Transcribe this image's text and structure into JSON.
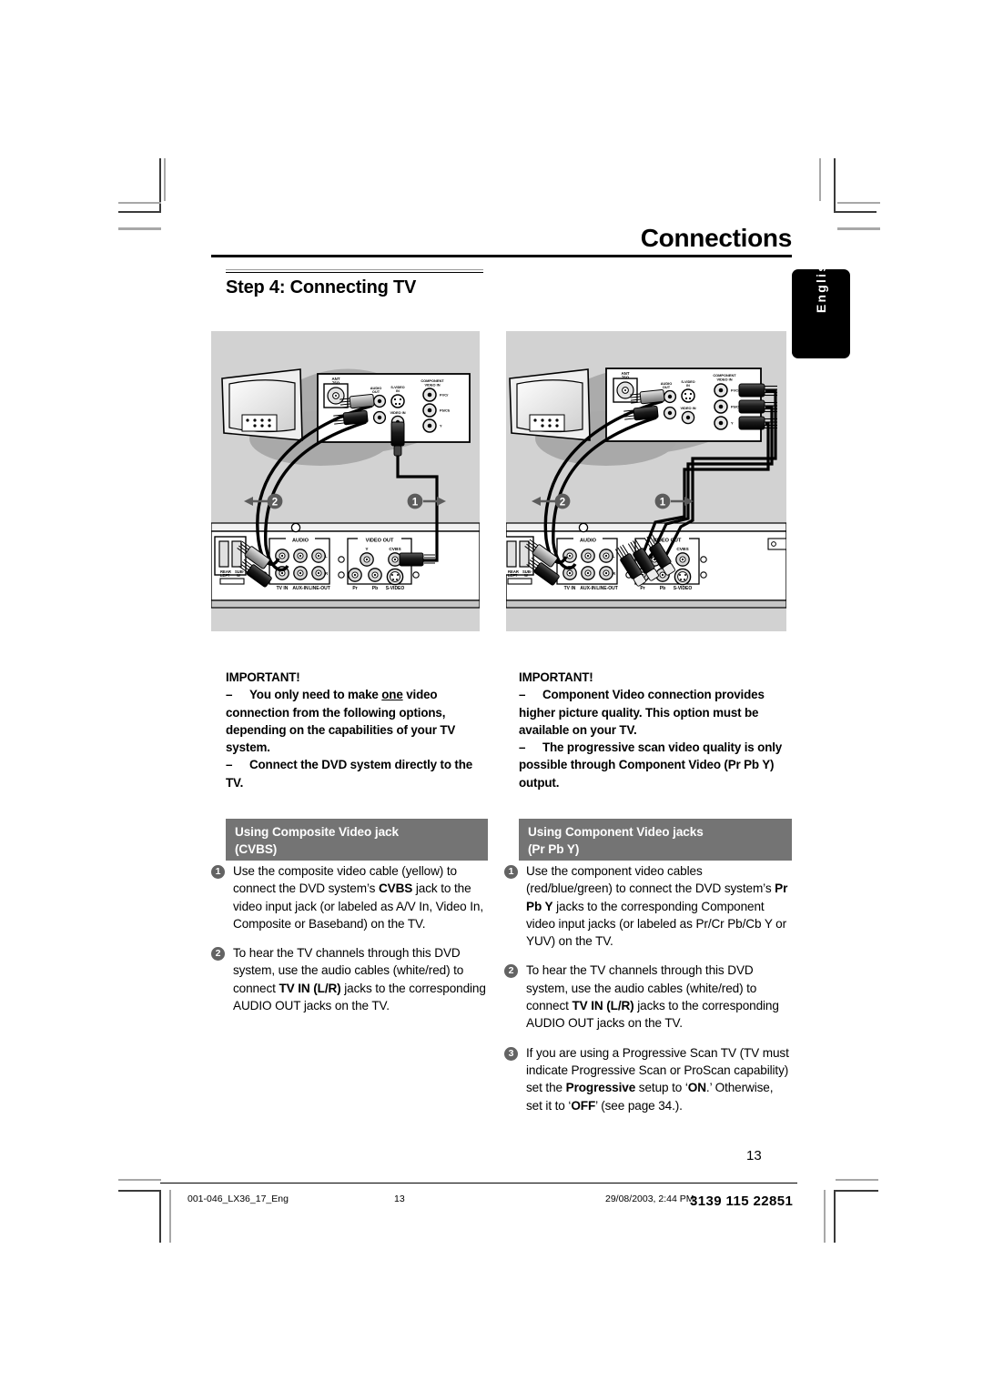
{
  "header": {
    "title": "Connections",
    "side_tab": "English"
  },
  "step": {
    "heading": "Step 4:  Connecting TV"
  },
  "diagrams": {
    "left": {
      "name": "composite-video-connection-diagram",
      "tv_panel": {
        "ant_label": "ANT",
        "ant_sub": "75Ω",
        "audio_out": "AUDIO OUT",
        "s_video_in": "S-VIDEO IN",
        "video_in": "VIDEO IN",
        "component_header": "COMPONENT VIDEO IN",
        "component_jacks": [
          "Pr/Cr",
          "Pb/Cb",
          "Y"
        ]
      },
      "dvd_panel": {
        "audio_group": "AUDIO",
        "audio_labels": [
          "TV IN",
          "AUX-IN",
          "LINE-OUT"
        ],
        "audio_channels": [
          "L",
          "R"
        ],
        "video_group": "VIDEO OUT",
        "video_labels": [
          "Y",
          "CVBS",
          "Pr",
          "Pb",
          "S-VIDEO"
        ],
        "speaker_labels": [
          "REAR LEFT",
          "SUB-W"
        ]
      },
      "callouts": [
        "1",
        "2"
      ]
    },
    "right": {
      "name": "component-video-connection-diagram",
      "tv_panel": {
        "ant_label": "ANT",
        "ant_sub": "75Ω",
        "audio_out": "AUDIO OUT",
        "s_video_in": "S-VIDEO IN",
        "video_in": "VIDEO IN",
        "component_header": "COMPONENT VIDEO IN",
        "component_jacks": [
          "Pr/Cr",
          "Pb/Cb",
          "Y"
        ]
      },
      "dvd_panel": {
        "audio_group": "AUDIO",
        "audio_labels": [
          "TV IN",
          "AUX-IN",
          "LINE-OUT"
        ],
        "audio_channels": [
          "L",
          "R"
        ],
        "video_group": "VIDEO OUT",
        "video_labels": [
          "Y",
          "CVBS",
          "Pr",
          "Pb",
          "S-VIDEO"
        ],
        "speaker_labels": [
          "REAR LEFT",
          "SUB-W"
        ]
      },
      "callouts": [
        "1",
        "2"
      ]
    }
  },
  "important_left": {
    "title": "IMPORTANT!",
    "item1_pre": "You only need to make ",
    "item1_underlined": "one",
    "item1_post": " video connection from the following options, depending on the capabilities of your TV system.",
    "item2": "Connect the DVD system directly to the TV.",
    "dash": "–"
  },
  "important_right": {
    "title": "IMPORTANT!",
    "item1": "Component Video connection provides higher picture quality. This option must be available on your TV.",
    "item2": "The progressive scan video quality is only possible through Component Video (Pr Pb Y) output.",
    "dash": "–"
  },
  "section_left": {
    "line1": "Using Composite Video jack",
    "line2": "(CVBS)"
  },
  "section_right": {
    "line1": "Using Component Video jacks",
    "line2": "(Pr Pb Y)"
  },
  "instructions_left": [
    {
      "num": "1",
      "parts": [
        {
          "t": "Use the composite video cable (yellow) to connect the DVD system’s ",
          "b": false
        },
        {
          "t": "CVBS",
          "b": true
        },
        {
          "t": " jack to the video input jack (or labeled as A/V In, Video In, Composite or Baseband) on the TV.",
          "b": false
        }
      ]
    },
    {
      "num": "2",
      "parts": [
        {
          "t": "To hear the TV channels through this DVD system, use the audio cables (white/red) to connect ",
          "b": false
        },
        {
          "t": "TV IN (L/R)",
          "b": true
        },
        {
          "t": " jacks to the corresponding AUDIO OUT jacks on the TV.",
          "b": false
        }
      ]
    }
  ],
  "instructions_right": [
    {
      "num": "1",
      "parts": [
        {
          "t": "Use the component video cables (red/blue/green) to connect the DVD system’s ",
          "b": false
        },
        {
          "t": "Pr Pb Y",
          "b": true
        },
        {
          "t": " jacks to the corresponding Component video input jacks (or labeled as Pr/Cr Pb/Cb Y or YUV) on the TV.",
          "b": false
        }
      ]
    },
    {
      "num": "2",
      "parts": [
        {
          "t": "To hear the TV channels through this DVD system, use the audio cables (white/red) to connect ",
          "b": false
        },
        {
          "t": "TV IN (L/R)",
          "b": true
        },
        {
          "t": " jacks to the corresponding AUDIO OUT jacks on the TV.",
          "b": false
        }
      ]
    },
    {
      "num": "3",
      "parts": [
        {
          "t": "If you are using a Progressive Scan TV (TV must indicate Progressive Scan or ProScan capability) set the ",
          "b": false
        },
        {
          "t": "Progressive",
          "b": true
        },
        {
          "t": " setup to ‘",
          "b": false
        },
        {
          "t": "ON",
          "b": true
        },
        {
          "t": ".’  Otherwise, set it to ‘",
          "b": false
        },
        {
          "t": "OFF",
          "b": true
        },
        {
          "t": "’ (see page 34.).",
          "b": false
        }
      ]
    }
  ],
  "page_number": "13",
  "footer": {
    "file": "001-046_LX36_17_Eng",
    "page": "13",
    "date": "29/08/2003, 2:44 PM",
    "code": "3139 115 22851"
  }
}
